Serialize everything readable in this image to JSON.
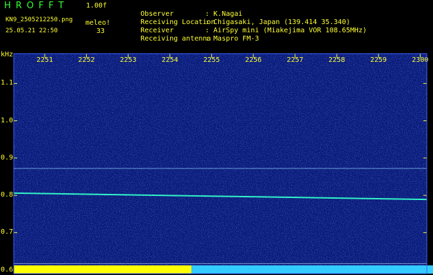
{
  "header": {
    "brand": "HROFFT",
    "version": "1.00f",
    "filename": "KN9_2505212250.png",
    "meleo_label": "meleo!",
    "datetime": "25.05.21 22:50",
    "count": "33",
    "meta": [
      {
        "label": "Observer",
        "value": ": K.Nagai"
      },
      {
        "label": "Receiving Location",
        "value": ": Chigasaki, Japan (139.414 35.340)"
      },
      {
        "label": "Receiver",
        "value": ": AirSpy mini (Miakejima VOR 108.65MHz)"
      },
      {
        "label": "Receiving antenna",
        "value": ": Maspro FM-3"
      }
    ]
  },
  "colors": {
    "background": "#000000",
    "text": "#ffff33",
    "brand": "#33ff33",
    "noise_base": "#0a1a78",
    "signal_line": "#33ffcc",
    "bar_yellow": "#ffff00",
    "bar_cyan": "#33ccff"
  },
  "chart_data": {
    "type": "heatmap",
    "ylabel": "kHz",
    "x_ticks": [
      "2251",
      "2252",
      "2253",
      "2254",
      "2255",
      "2256",
      "2257",
      "2258",
      "2259",
      "2300"
    ],
    "y_ticks": [
      1.1,
      1.0,
      0.9,
      0.8,
      0.7,
      0.6
    ],
    "ylim": [
      0.59,
      1.18
    ],
    "lines": [
      {
        "kind": "signal",
        "y_start": 0.806,
        "y_end": 0.789
      },
      {
        "kind": "reference",
        "y_start": 0.872,
        "y_end": 0.872
      }
    ],
    "bottom_bar": [
      {
        "color": "yellow",
        "from": "2250",
        "to": "2254.3"
      },
      {
        "color": "cyan",
        "from": "2254.3",
        "to": "2300"
      }
    ]
  }
}
